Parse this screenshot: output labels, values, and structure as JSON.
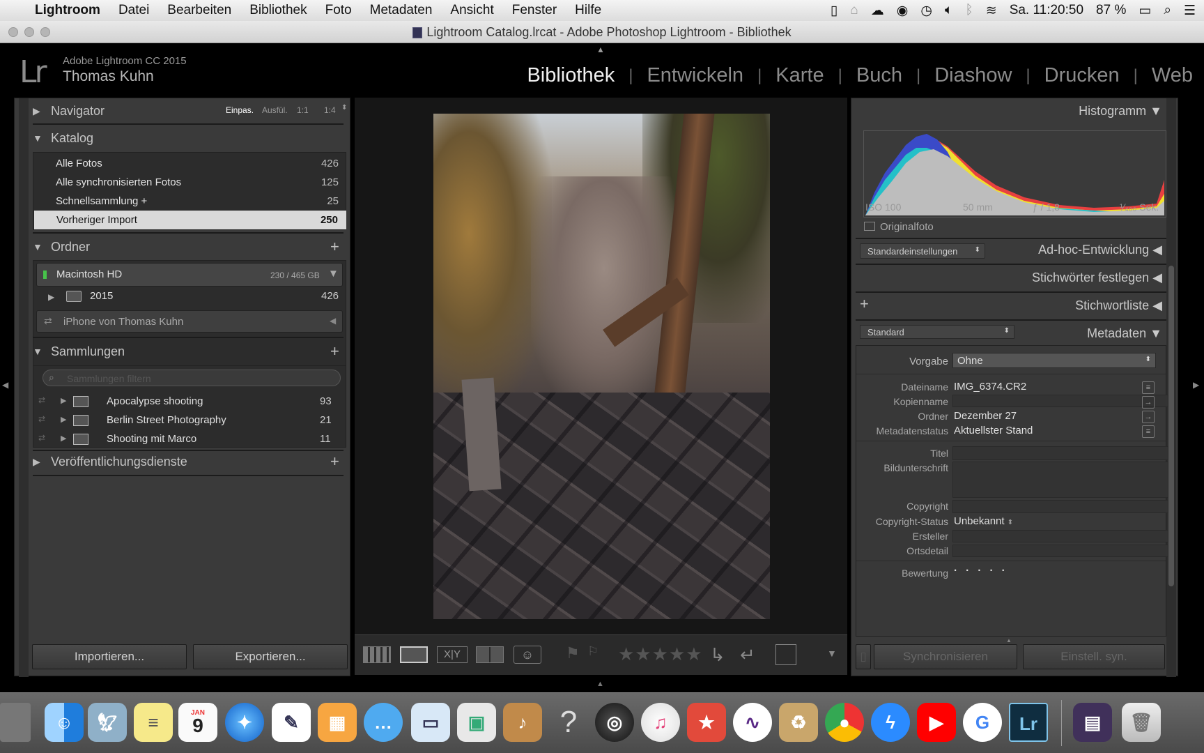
{
  "menubar": {
    "apple": "",
    "app_name": "Lightroom",
    "items": [
      "Datei",
      "Bearbeiten",
      "Bibliothek",
      "Foto",
      "Metadaten",
      "Ansicht",
      "Fenster",
      "Hilfe"
    ],
    "clock": "Sa. 11:20:50",
    "battery": "87 %"
  },
  "window": {
    "title": "Lightroom Catalog.lrcat - Adobe Photoshop Lightroom - Bibliothek"
  },
  "identity": {
    "logo": "Lr",
    "product": "Adobe Lightroom CC 2015",
    "user": "Thomas Kuhn"
  },
  "modules": [
    "Bibliothek",
    "Entwickeln",
    "Karte",
    "Buch",
    "Diashow",
    "Drucken",
    "Web"
  ],
  "active_module": "Bibliothek",
  "left": {
    "navigator": {
      "title": "Navigator",
      "zoom": [
        "Einpas.",
        "Ausfül.",
        "1:1",
        "1:4"
      ]
    },
    "catalog": {
      "title": "Katalog",
      "rows": [
        {
          "label": "Alle Fotos",
          "count": "426"
        },
        {
          "label": "Alle synchronisierten Fotos",
          "count": "125"
        },
        {
          "label": "Schnellsammlung +",
          "count": "25"
        },
        {
          "label": "Vorheriger Import",
          "count": "250"
        }
      ]
    },
    "folders": {
      "title": "Ordner",
      "volume": "Macintosh HD",
      "volume_size": "230 / 465 GB",
      "folder": "2015",
      "folder_count": "426",
      "device": "iPhone von Thomas Kuhn"
    },
    "collections": {
      "title": "Sammlungen",
      "filter_placeholder": "Sammlungen filtern",
      "items": [
        {
          "label": "Apocalypse shooting",
          "count": "93"
        },
        {
          "label": "Berlin Street Photography",
          "count": "21"
        },
        {
          "label": "Shooting mit Marco",
          "count": "11"
        }
      ]
    },
    "publish": {
      "title": "Veröffentlichungsdienste"
    },
    "import_btn": "Importieren...",
    "export_btn": "Exportieren..."
  },
  "right": {
    "histogram": {
      "title": "Histogramm",
      "iso": "ISO 100",
      "focal": "50 mm",
      "aperture": "ƒ / 1,8",
      "shutter": "¹⁄₄₀₀ Sek.",
      "original_label": "Originalfoto"
    },
    "quick_develop": {
      "preset": "Standardeinstellungen",
      "title": "Ad-hoc-Entwicklung"
    },
    "keywording": {
      "title": "Stichwörter festlegen"
    },
    "keyword_list": {
      "title": "Stichwortliste"
    },
    "metadata": {
      "preset_select": "Standard",
      "title": "Metadaten",
      "vorgabe_label": "Vorgabe",
      "vorgabe_value": "Ohne",
      "fields": [
        {
          "label": "Dateiname",
          "value": "IMG_6374.CR2"
        },
        {
          "label": "Kopienname",
          "value": ""
        },
        {
          "label": "Ordner",
          "value": "Dezember 27"
        },
        {
          "label": "Metadatenstatus",
          "value": "Aktuellster Stand"
        }
      ],
      "titel_label": "Titel",
      "caption_label": "Bildunterschrift",
      "copyright_label": "Copyright",
      "copyright_status_label": "Copyright-Status",
      "copyright_status_value": "Unbekannt",
      "creator_label": "Ersteller",
      "location_label": "Ortsdetail",
      "rating_label": "Bewertung",
      "rating_value": "· · · · ·"
    },
    "sync_btn": "Synchronisieren",
    "sync_settings_btn": "Einstell. syn."
  },
  "toolbar": {
    "stars": "★★★★★"
  },
  "dock": {
    "apps": [
      "Finder",
      "Vorschau",
      "Notizen",
      "Kalender",
      "Safari",
      "TextEdit",
      "Bildschirmfoto",
      "Nachrichten",
      "Keynote",
      "Bildübersicht",
      "GarageBand",
      "Hilfe",
      "Photo Booth",
      "iTunes",
      "Lesezeichen",
      "Notable",
      "Archiv",
      "Chrome",
      "Messenger",
      "YouTube",
      "Google",
      "Lightroom",
      "Dokumente",
      "Papierkorb"
    ],
    "calendar_month": "JAN",
    "calendar_day": "9"
  },
  "colors": {
    "accent": "#f0f0f0",
    "panel": "#3a3a3a",
    "selected_row": "#d9d9d9"
  }
}
